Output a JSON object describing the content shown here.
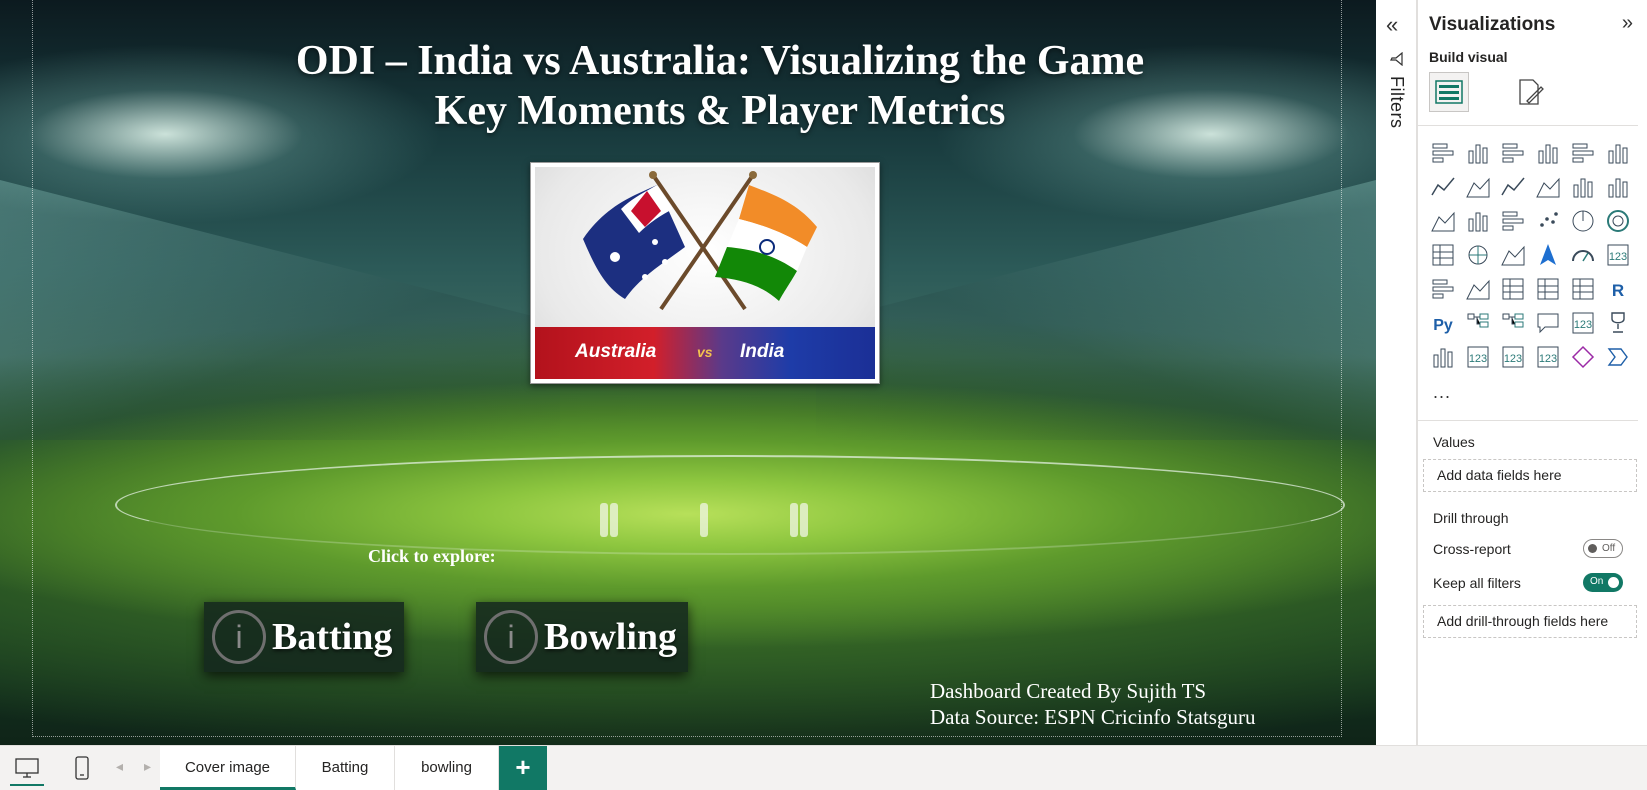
{
  "canvas": {
    "title_line1": "ODI  – India vs Australia: Visualizing the Game",
    "title_line2": "Key Moments & Player Metrics",
    "banner": {
      "team1": "Australia",
      "vs": "vs",
      "team2": "India"
    },
    "explore_label": "Click to explore:",
    "buttons": [
      {
        "label": "Batting",
        "icon": "info-icon"
      },
      {
        "label": "Bowling",
        "icon": "info-icon"
      }
    ],
    "credits": {
      "line1": "Dashboard Created By Sujith TS",
      "line2": "Data Source: ESPN Cricinfo Statsguru"
    }
  },
  "filters_pane": {
    "label": "Filters",
    "collapse_icon": "double-chevron-left-icon",
    "funnel_icon": "funnel-icon"
  },
  "viz_pane": {
    "title": "Visualizations",
    "collapse_icon": "double-chevron-right-icon",
    "build_label": "Build visual",
    "more": "...",
    "values_label": "Values",
    "values_placeholder": "Add data fields here",
    "drill_label": "Drill through",
    "cross_report": {
      "label": "Cross-report",
      "state": "Off"
    },
    "keep_filters": {
      "label": "Keep all filters",
      "state": "On"
    },
    "drill_placeholder": "Add drill-through fields here",
    "visual_icons": [
      "stacked-bar-icon",
      "stacked-column-icon",
      "clustered-bar-icon",
      "clustered-column-icon",
      "100-stacked-bar-icon",
      "100-stacked-column-icon",
      "line-chart-icon",
      "area-chart-icon",
      "stacked-area-icon",
      "100-stacked-area-icon",
      "line-clustered-column-icon",
      "line-stacked-column-icon",
      "ribbon-chart-icon",
      "waterfall-icon",
      "funnel-chart-icon",
      "scatter-icon",
      "pie-chart-icon",
      "donut-chart-icon",
      "treemap-icon",
      "map-icon",
      "filled-map-icon",
      "azure-map-icon",
      "gauge-icon",
      "card-icon",
      "multi-row-card-icon",
      "kpi-icon",
      "slicer-icon",
      "table-icon",
      "matrix-icon",
      "r-visual-icon",
      "python-visual-icon",
      "key-influencers-icon",
      "decomposition-tree-icon",
      "qa-icon",
      "narrative-icon",
      "goals-icon",
      "paginated-report-icon",
      "power-apps-icon",
      "power-automate-icon",
      "arcgis-icon",
      "power-apps-diamond-icon",
      "custom-visual-icon"
    ]
  },
  "page_bar": {
    "tabs": [
      "Cover image",
      "Batting",
      "bowling"
    ],
    "active_tab": "Cover image",
    "add": "+"
  },
  "colors": {
    "accent": "#117865",
    "toggle_on": "#117865",
    "banner_red": "#d21f2a",
    "banner_blue": "#1e3ca8"
  }
}
